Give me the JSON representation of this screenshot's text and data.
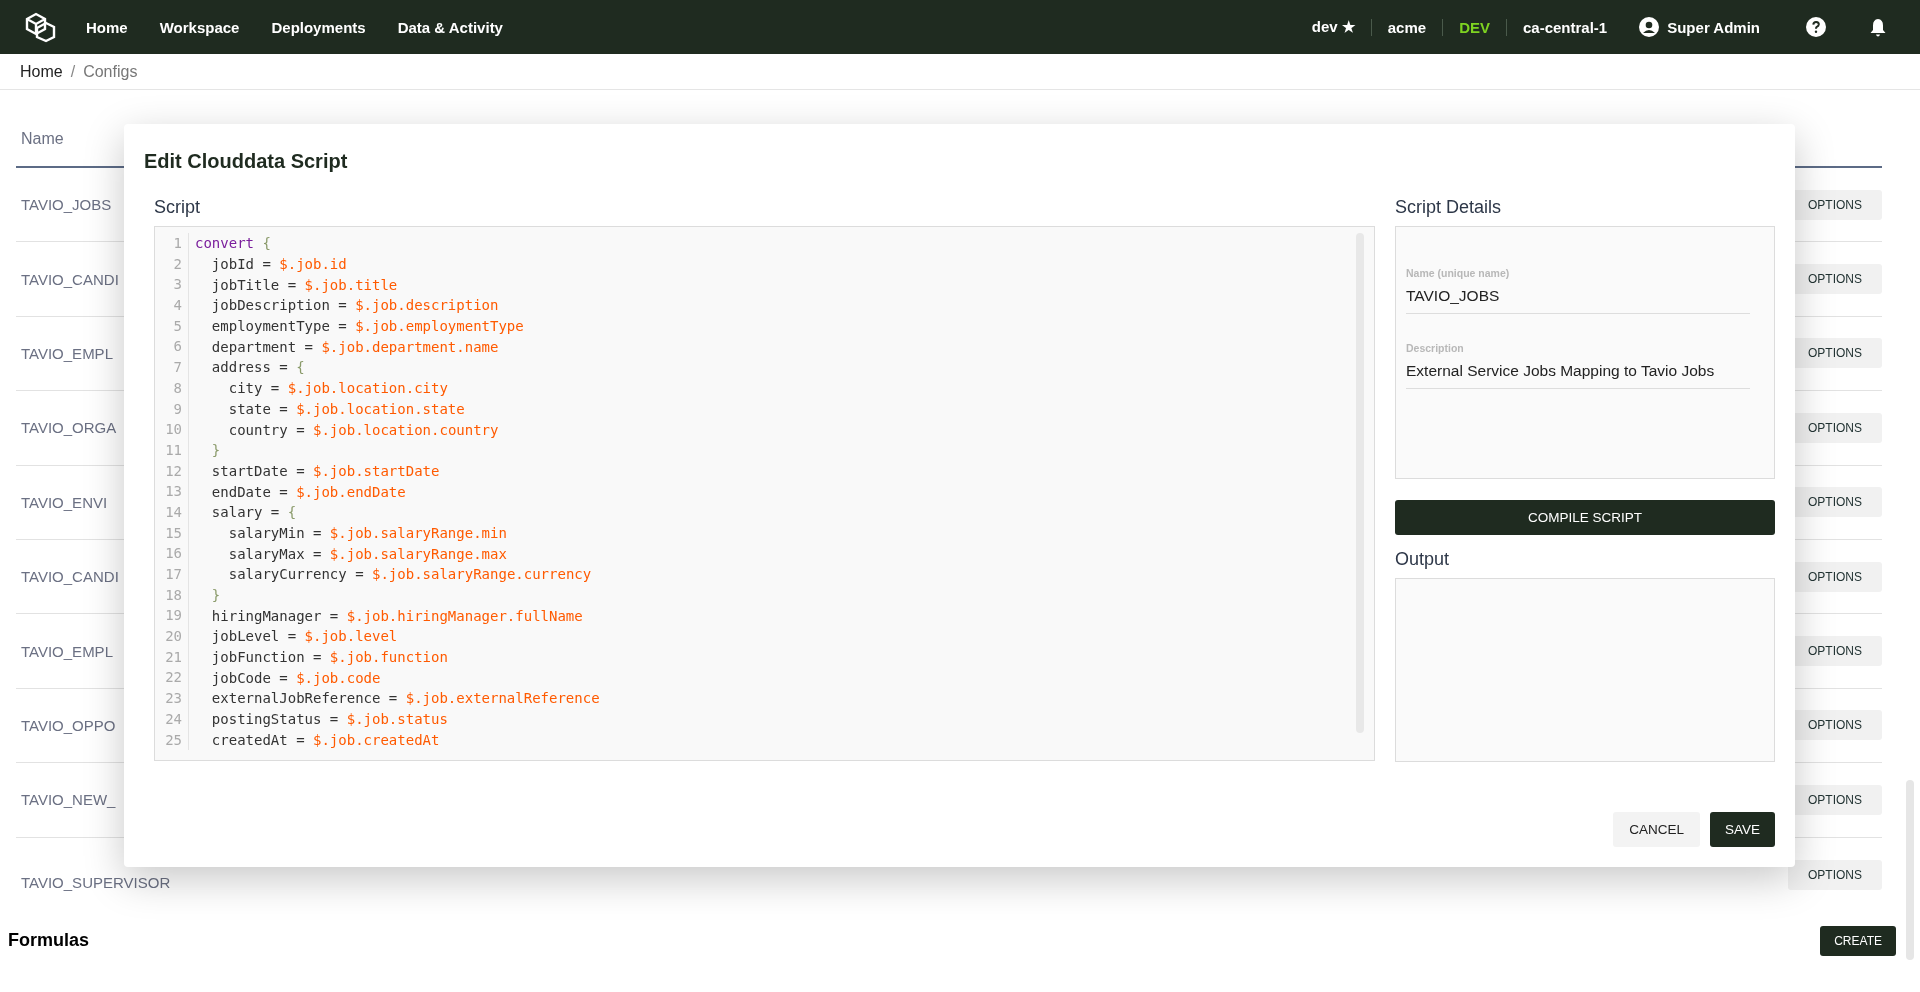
{
  "nav": {
    "items": [
      {
        "label": "Home"
      },
      {
        "label": "Workspace"
      },
      {
        "label": "Deployments"
      },
      {
        "label": "Data & Activity"
      }
    ],
    "right": [
      {
        "kind": "starred",
        "label": "dev",
        "mark": "★"
      },
      {
        "kind": "plain",
        "label": "acme"
      },
      {
        "kind": "env",
        "label": "DEV",
        "color": "#7ed321"
      },
      {
        "kind": "plain",
        "label": "ca-central-1"
      },
      {
        "kind": "user",
        "label": "Super Admin"
      }
    ]
  },
  "breadcrumb": [
    {
      "label": "Home",
      "current": false
    },
    {
      "label": "Configs",
      "current": true
    }
  ],
  "breadcrumb_separator": "/",
  "table": {
    "columns": [
      "Name"
    ],
    "rows": [
      {
        "name": "TAVIO_JOBS",
        "action": "OPTIONS"
      },
      {
        "name": "TAVIO_CANDI",
        "action": "OPTIONS"
      },
      {
        "name": "TAVIO_EMPL",
        "action": "OPTIONS"
      },
      {
        "name": "TAVIO_ORGA",
        "action": "OPTIONS"
      },
      {
        "name": "TAVIO_ENVI",
        "action": "OPTIONS"
      },
      {
        "name": "TAVIO_CANDI",
        "action": "OPTIONS"
      },
      {
        "name": "TAVIO_EMPL",
        "action": "OPTIONS"
      },
      {
        "name": "TAVIO_OPPO",
        "action": "OPTIONS"
      },
      {
        "name": "TAVIO_NEW_",
        "action": "OPTIONS"
      },
      {
        "name": "TAVIO_SUPERVISOR",
        "action": "OPTIONS"
      }
    ]
  },
  "formulas": {
    "title": "Formulas",
    "create_label": "CREATE"
  },
  "dialog": {
    "title": "Edit Clouddata Script",
    "script_label": "Script",
    "code": [
      {
        "number": "1",
        "tokens": [
          {
            "kind": "keyword",
            "text": "convert"
          },
          {
            "kind": "brace",
            "text": " {"
          }
        ]
      },
      {
        "number": "2",
        "tokens": [
          {
            "kind": "plain",
            "text": "  jobId = "
          },
          {
            "kind": "value",
            "text": "$.job.id"
          }
        ]
      },
      {
        "number": "3",
        "tokens": [
          {
            "kind": "plain",
            "text": "  jobTitle = "
          },
          {
            "kind": "value",
            "text": "$.job.title"
          }
        ]
      },
      {
        "number": "4",
        "tokens": [
          {
            "kind": "plain",
            "text": "  jobDescription = "
          },
          {
            "kind": "value",
            "text": "$.job.description"
          }
        ]
      },
      {
        "number": "5",
        "tokens": [
          {
            "kind": "plain",
            "text": "  employmentType = "
          },
          {
            "kind": "value",
            "text": "$.job.employmentType"
          }
        ]
      },
      {
        "number": "6",
        "tokens": [
          {
            "kind": "plain",
            "text": "  department = "
          },
          {
            "kind": "value",
            "text": "$.job.department.name"
          }
        ]
      },
      {
        "number": "7",
        "tokens": [
          {
            "kind": "plain",
            "text": "  address = "
          },
          {
            "kind": "brace",
            "text": "{"
          }
        ]
      },
      {
        "number": "8",
        "tokens": [
          {
            "kind": "plain",
            "text": "    city = "
          },
          {
            "kind": "value",
            "text": "$.job.location.city"
          }
        ]
      },
      {
        "number": "9",
        "tokens": [
          {
            "kind": "plain",
            "text": "    state = "
          },
          {
            "kind": "value",
            "text": "$.job.location.state"
          }
        ]
      },
      {
        "number": "10",
        "tokens": [
          {
            "kind": "plain",
            "text": "    country = "
          },
          {
            "kind": "value",
            "text": "$.job.location.country"
          }
        ]
      },
      {
        "number": "11",
        "tokens": [
          {
            "kind": "brace",
            "text": "  }"
          }
        ]
      },
      {
        "number": "12",
        "tokens": [
          {
            "kind": "plain",
            "text": "  startDate = "
          },
          {
            "kind": "value",
            "text": "$.job.startDate"
          }
        ]
      },
      {
        "number": "13",
        "tokens": [
          {
            "kind": "plain",
            "text": "  endDate = "
          },
          {
            "kind": "value",
            "text": "$.job.endDate"
          }
        ]
      },
      {
        "number": "14",
        "tokens": [
          {
            "kind": "plain",
            "text": "  salary = "
          },
          {
            "kind": "brace",
            "text": "{"
          }
        ]
      },
      {
        "number": "15",
        "tokens": [
          {
            "kind": "plain",
            "text": "    salaryMin = "
          },
          {
            "kind": "value",
            "text": "$.job.salaryRange.min"
          }
        ]
      },
      {
        "number": "16",
        "tokens": [
          {
            "kind": "plain",
            "text": "    salaryMax = "
          },
          {
            "kind": "value",
            "text": "$.job.salaryRange.max"
          }
        ]
      },
      {
        "number": "17",
        "tokens": [
          {
            "kind": "plain",
            "text": "    salaryCurrency = "
          },
          {
            "kind": "value",
            "text": "$.job.salaryRange.currency"
          }
        ]
      },
      {
        "number": "18",
        "tokens": [
          {
            "kind": "brace",
            "text": "  }"
          }
        ]
      },
      {
        "number": "19",
        "tokens": [
          {
            "kind": "plain",
            "text": "  hiringManager = "
          },
          {
            "kind": "value",
            "text": "$.job.hiringManager.fullName"
          }
        ]
      },
      {
        "number": "20",
        "tokens": [
          {
            "kind": "plain",
            "text": "  jobLevel = "
          },
          {
            "kind": "value",
            "text": "$.job.level"
          }
        ]
      },
      {
        "number": "21",
        "tokens": [
          {
            "kind": "plain",
            "text": "  jobFunction = "
          },
          {
            "kind": "value",
            "text": "$.job.function"
          }
        ]
      },
      {
        "number": "22",
        "tokens": [
          {
            "kind": "plain",
            "text": "  jobCode = "
          },
          {
            "kind": "value",
            "text": "$.job.code"
          }
        ]
      },
      {
        "number": "23",
        "tokens": [
          {
            "kind": "plain",
            "text": "  externalJobReference = "
          },
          {
            "kind": "value",
            "text": "$.job.externalReference"
          }
        ]
      },
      {
        "number": "24",
        "tokens": [
          {
            "kind": "plain",
            "text": "  postingStatus = "
          },
          {
            "kind": "value",
            "text": "$.job.status"
          }
        ]
      },
      {
        "number": "25",
        "tokens": [
          {
            "kind": "plain",
            "text": "  createdAt = "
          },
          {
            "kind": "value",
            "text": "$.job.createdAt"
          }
        ]
      }
    ],
    "details_label": "Script Details",
    "fields": [
      {
        "label": "Name (unique name)",
        "value": "TAVIO_JOBS"
      },
      {
        "label": "Description",
        "value": "External Service Jobs Mapping to Tavio Jobs"
      }
    ],
    "compile_label": "COMPILE SCRIPT",
    "output_label": "Output",
    "buttons": [
      {
        "label": "CANCEL",
        "primary": false
      },
      {
        "label": "SAVE",
        "primary": true
      }
    ]
  }
}
